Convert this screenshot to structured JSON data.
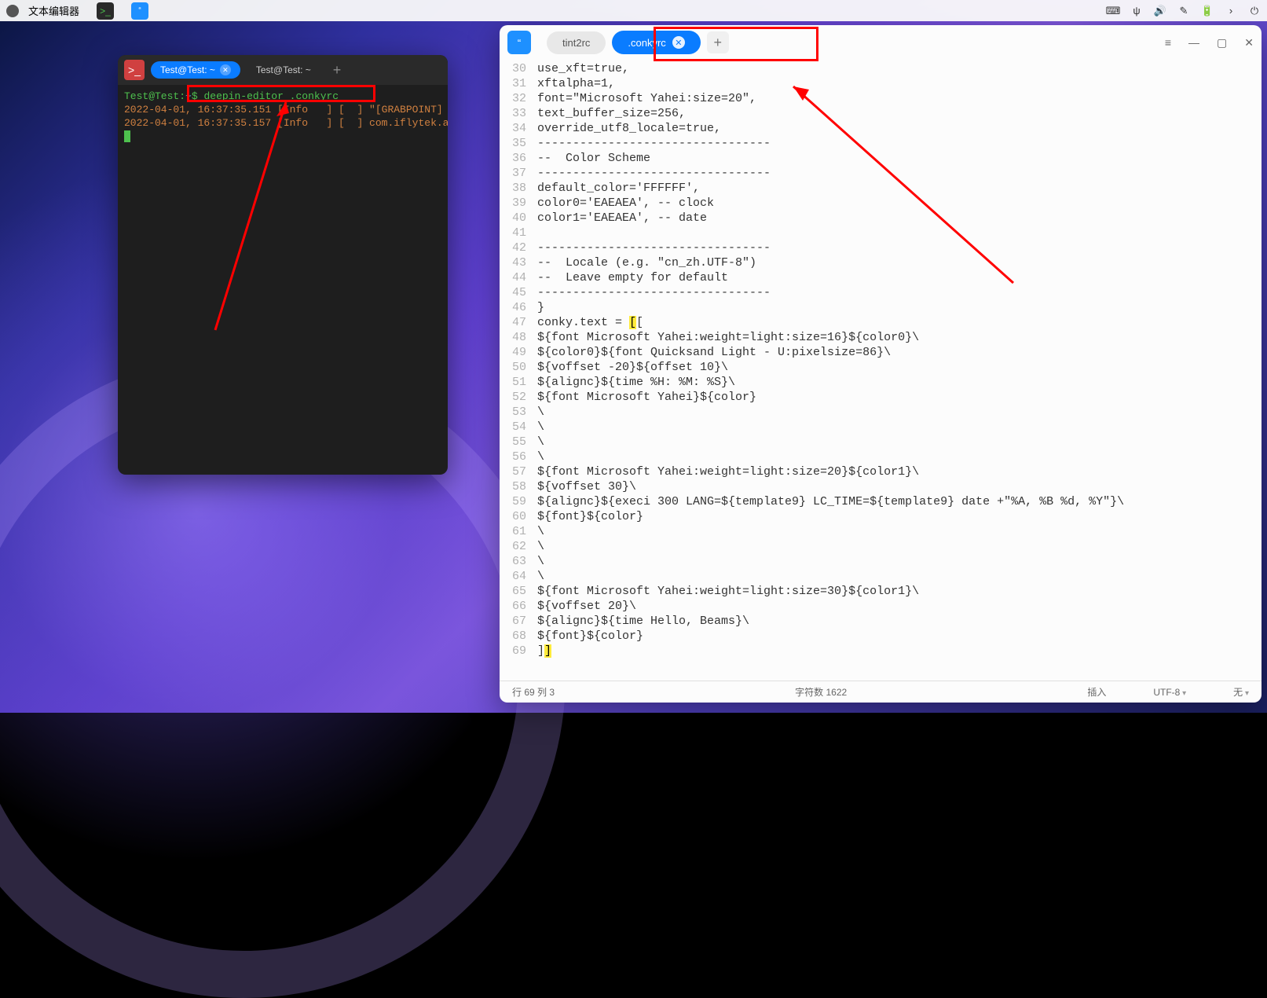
{
  "topbar": {
    "app_title": "文本编辑器"
  },
  "tray": {
    "keyboard": "⌨",
    "usb": "ψ",
    "sound": "🔊",
    "edit": "✎",
    "battery": "🔋",
    "more": "›",
    "power": "⏻"
  },
  "terminal": {
    "tab1": "Test@Test: ~",
    "tab2": "Test@Test: ~",
    "prompt_user": "Test@Test",
    "prompt_sep": ":",
    "prompt_path": "~",
    "prompt_sym": "$",
    "command": "deepin-editor .conkyrc",
    "log1": "2022-04-01, 16:37:35.151 [Info   ] [  ] \"[GRABPOINT]",
    "log2": "2022-04-01, 16:37:35.157 [Info   ] [  ] com.iflytek.a"
  },
  "editor": {
    "tab1": "tint2rc",
    "tab2": ".conkyrc",
    "lines": [
      {
        "n": "30",
        "t": "use_xft=true,"
      },
      {
        "n": "31",
        "t": "xftalpha=1,"
      },
      {
        "n": "32",
        "t": "font=\"Microsoft Yahei:size=20\","
      },
      {
        "n": "33",
        "t": "text_buffer_size=256,"
      },
      {
        "n": "34",
        "t": "override_utf8_locale=true,"
      },
      {
        "n": "35",
        "t": "---------------------------------"
      },
      {
        "n": "36",
        "t": "--  Color Scheme"
      },
      {
        "n": "37",
        "t": "---------------------------------"
      },
      {
        "n": "38",
        "t": "default_color='FFFFFF',"
      },
      {
        "n": "39",
        "t": "color0='EAEAEA', -- clock"
      },
      {
        "n": "40",
        "t": "color1='EAEAEA', -- date"
      },
      {
        "n": "41",
        "t": ""
      },
      {
        "n": "42",
        "t": "---------------------------------"
      },
      {
        "n": "43",
        "t": "--  Locale (e.g. \"cn_zh.UTF-8\")"
      },
      {
        "n": "44",
        "t": "--  Leave empty for default"
      },
      {
        "n": "45",
        "t": "---------------------------------"
      },
      {
        "n": "46",
        "t": "}"
      },
      {
        "n": "47",
        "t": "conky.text = ",
        "hl": "[",
        "t2": "["
      },
      {
        "n": "48",
        "t": "${font Microsoft Yahei:weight=light:size=16}${color0}\\"
      },
      {
        "n": "49",
        "t": "${color0}${font Quicksand Light - U:pixelsize=86}\\"
      },
      {
        "n": "50",
        "t": "${voffset -20}${offset 10}\\"
      },
      {
        "n": "51",
        "t": "${alignc}${time %H: %M: %S}\\"
      },
      {
        "n": "52",
        "t": "${font Microsoft Yahei}${color}"
      },
      {
        "n": "53",
        "t": "\\"
      },
      {
        "n": "54",
        "t": "\\"
      },
      {
        "n": "55",
        "t": "\\"
      },
      {
        "n": "56",
        "t": "\\"
      },
      {
        "n": "57",
        "t": "${font Microsoft Yahei:weight=light:size=20}${color1}\\"
      },
      {
        "n": "58",
        "t": "${voffset 30}\\"
      },
      {
        "n": "59",
        "t": "${alignc}${execi 300 LANG=${template9} LC_TIME=${template9} date +\"%A, %B %d, %Y\"}\\"
      },
      {
        "n": "60",
        "t": "${font}${color}"
      },
      {
        "n": "61",
        "t": "\\"
      },
      {
        "n": "62",
        "t": "\\"
      },
      {
        "n": "63",
        "t": "\\"
      },
      {
        "n": "64",
        "t": "\\"
      },
      {
        "n": "65",
        "t": "${font Microsoft Yahei:weight=light:size=30}${color1}\\"
      },
      {
        "n": "66",
        "t": "${voffset 20}\\"
      },
      {
        "n": "67",
        "t": "${alignc}${time Hello, Beams}\\"
      },
      {
        "n": "68",
        "t": "${font}${color}"
      },
      {
        "n": "69",
        "t": "]",
        "hl": "]"
      }
    ],
    "status": {
      "pos": "行 69  列 3",
      "chars": "字符数 1622",
      "insert": "插入",
      "encoding": "UTF-8",
      "lang": "无"
    }
  }
}
